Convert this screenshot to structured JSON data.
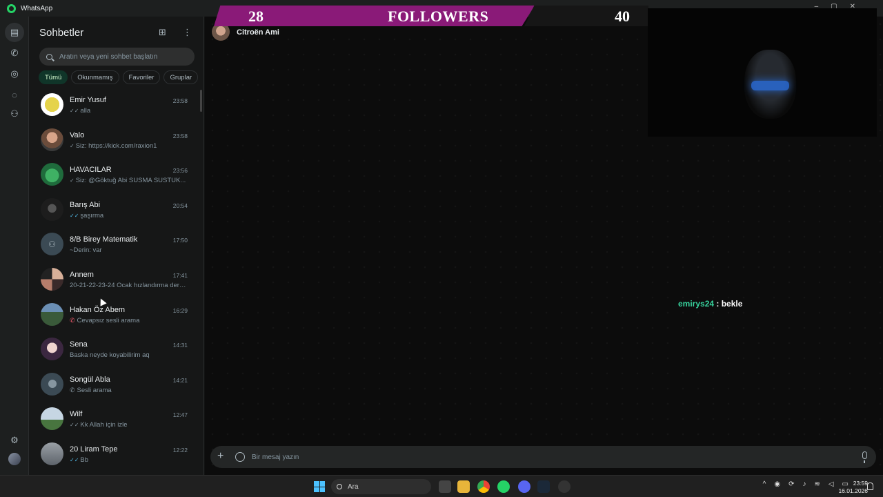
{
  "app": {
    "title": "WhatsApp"
  },
  "sidebar": {
    "title": "Sohbetler",
    "search_placeholder": "Aratın veya yeni sohbet başlatın",
    "filters": [
      {
        "label": "Tümü",
        "active": true
      },
      {
        "label": "Okunmamış",
        "active": false
      },
      {
        "label": "Favoriler",
        "active": false
      },
      {
        "label": "Gruplar",
        "active": false
      }
    ],
    "chats": [
      {
        "name": "Emir Yusuf",
        "time": "23:58",
        "preview": "alla",
        "status": "read"
      },
      {
        "name": "Valo",
        "time": "23:58",
        "preview": "Siz: https://kick.com/raxion1",
        "status": "sent"
      },
      {
        "name": "HAVACILAR",
        "time": "23:56",
        "preview": "Siz: @Göktuğ Abi  SUSMA SUSTUK...",
        "status": "sent"
      },
      {
        "name": "Barış Abi",
        "time": "20:54",
        "preview": "şaşırma",
        "status": "read"
      },
      {
        "name": "8/B Birey Matematik",
        "time": "17:50",
        "preview": "~Derin: var",
        "status": "none"
      },
      {
        "name": "Annem",
        "time": "17:41",
        "preview": "20-21-22-23-24 Ocak hızlandırma ders ...",
        "status": "none"
      },
      {
        "name": "Hakan Öz Abem",
        "time": "16:29",
        "preview": "Cevapsız sesli arama",
        "status": "missed-call"
      },
      {
        "name": "Sena",
        "time": "14:31",
        "preview": "Baska neyde koyabilirim aq",
        "status": "none"
      },
      {
        "name": "Songül Abla",
        "time": "14:21",
        "preview": "Sesli arama",
        "status": "call"
      },
      {
        "name": "Wilf",
        "time": "12:47",
        "preview": "Kk Allah için izle",
        "status": "read"
      },
      {
        "name": "20 Liram Tepe",
        "time": "12:22",
        "preview": "Bb",
        "status": "read"
      }
    ]
  },
  "chat": {
    "contact_name": "Citroën Ami",
    "composer_placeholder": "Bir mesaj yazın"
  },
  "overlay": {
    "followers_current": "28",
    "followers_label": "FOLLOWERS",
    "followers_goal": "40",
    "chat_user": "emirys24",
    "chat_separator": " : ",
    "chat_text": "bekle"
  },
  "taskbar": {
    "search_label": "Ara",
    "time": "23:59",
    "date": "16.01.2026"
  },
  "colors": {
    "accent": "#25d366",
    "followers_bar": "#8a1a78",
    "overlay_username": "#37d39d"
  }
}
